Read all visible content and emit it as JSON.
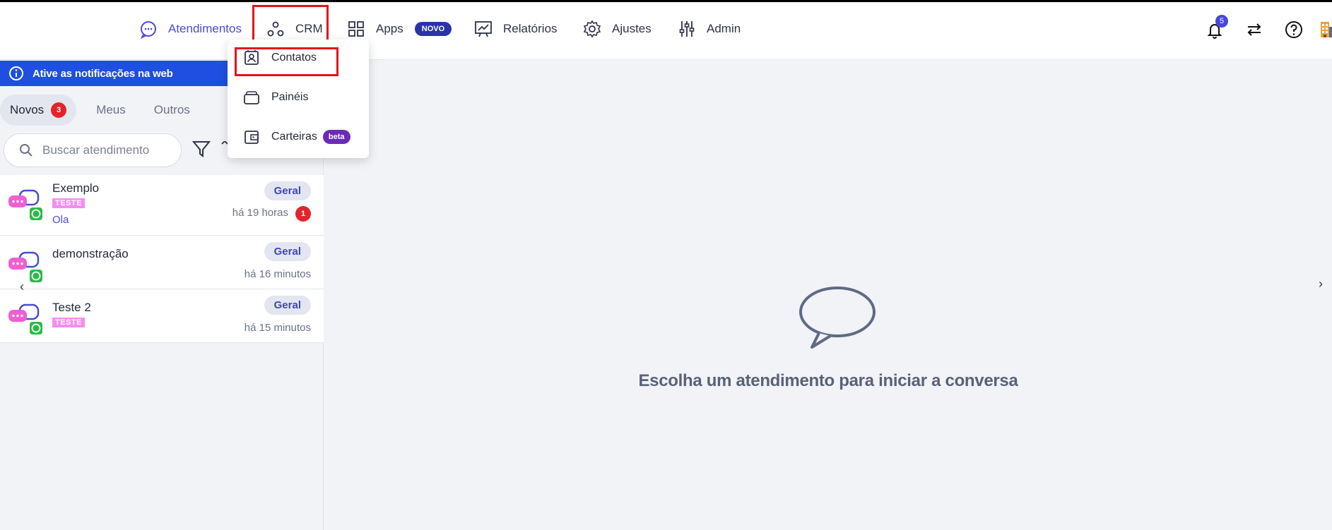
{
  "nav": {
    "atendimentos": "Atendimentos",
    "crm": "CRM",
    "apps": "Apps",
    "apps_badge": "NOVO",
    "relatorios": "Relatórios",
    "ajustes": "Ajustes",
    "admin": "Admin",
    "notification_count": "5"
  },
  "crm_menu": {
    "items": [
      {
        "label": "Contatos",
        "icon": "contact-card-icon"
      },
      {
        "label": "Painéis",
        "icon": "panels-icon"
      },
      {
        "label": "Carteiras",
        "icon": "wallet-icon",
        "badge": "beta"
      }
    ]
  },
  "banner": {
    "text": "Ative as notificações na web"
  },
  "tabs": {
    "novos": "Novos",
    "novos_count": "3",
    "meus": "Meus",
    "outros": "Outros"
  },
  "search": {
    "placeholder": "Buscar atendimento"
  },
  "conversations": [
    {
      "name": "Exemplo",
      "tag": "TESTE",
      "message": "Ola",
      "queue": "Geral",
      "time": "há 19 horas",
      "unread": "1"
    },
    {
      "name": "demonstração",
      "tag": "",
      "message": "",
      "queue": "Geral",
      "time": "há 16 minutos",
      "unread": ""
    },
    {
      "name": "Teste 2",
      "tag": "TESTE",
      "message": "",
      "queue": "Geral",
      "time": "há 15 minutos",
      "unread": ""
    }
  ],
  "empty_state": {
    "text": "Escolha um atendimento para iniciar a conversa"
  },
  "colors": {
    "accent": "#4a4ad6",
    "banner": "#1e4fe0",
    "highlight": "#e4111b",
    "unread": "#e4232b",
    "tag": "#f48df0",
    "beta": "#6a2bb8"
  }
}
